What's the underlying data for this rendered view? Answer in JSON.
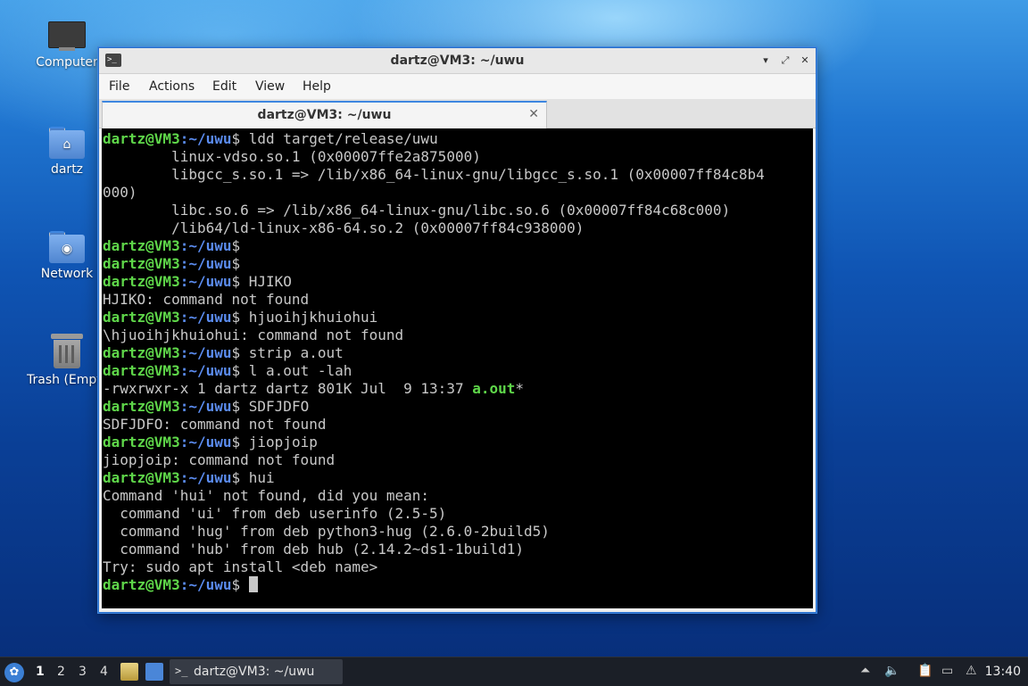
{
  "desktop": {
    "icons": [
      {
        "label": "Computer"
      },
      {
        "label": "dartz"
      },
      {
        "label": "Network"
      },
      {
        "label": "Trash (Empty)"
      }
    ]
  },
  "window": {
    "title": "dartz@VM3: ~/uwu",
    "tab_label": "dartz@VM3: ~/uwu",
    "menu": [
      "File",
      "Actions",
      "Edit",
      "View",
      "Help"
    ]
  },
  "terminal": {
    "prompt_user": "dartz@VM3",
    "prompt_path": ":~/uwu",
    "prompt_symbol": "$",
    "lines": [
      {
        "type": "cmd",
        "text": " ldd target/release/uwu"
      },
      {
        "type": "out",
        "text": "        linux-vdso.so.1 (0x00007ffe2a875000)"
      },
      {
        "type": "out",
        "text": "        libgcc_s.so.1 => /lib/x86_64-linux-gnu/libgcc_s.so.1 (0x00007ff84c8b4"
      },
      {
        "type": "out",
        "text": "000)"
      },
      {
        "type": "out",
        "text": "        libc.so.6 => /lib/x86_64-linux-gnu/libc.so.6 (0x00007ff84c68c000)"
      },
      {
        "type": "out",
        "text": "        /lib64/ld-linux-x86-64.so.2 (0x00007ff84c938000)"
      },
      {
        "type": "cmd",
        "text": ""
      },
      {
        "type": "cmd",
        "text": ""
      },
      {
        "type": "cmd",
        "text": " HJIKO"
      },
      {
        "type": "out",
        "text": "HJIKO: command not found"
      },
      {
        "type": "cmd",
        "text": " hjuoihjkhuiohui"
      },
      {
        "type": "out",
        "text": "\\hjuoihjkhuiohui: command not found"
      },
      {
        "type": "cmd",
        "text": " strip a.out"
      },
      {
        "type": "cmd",
        "text": " l a.out -lah"
      },
      {
        "type": "ls",
        "text": "-rwxrwxr-x 1 dartz dartz 801K Jul  9 13:37 ",
        "exec": "a.out",
        "suffix": "*"
      },
      {
        "type": "cmd",
        "text": " SDFJDFO"
      },
      {
        "type": "out",
        "text": "SDFJDFO: command not found"
      },
      {
        "type": "cmd",
        "text": " jiopjoip"
      },
      {
        "type": "out",
        "text": "jiopjoip: command not found"
      },
      {
        "type": "cmd",
        "text": " hui"
      },
      {
        "type": "out",
        "text": "Command 'hui' not found, did you mean:"
      },
      {
        "type": "out",
        "text": "  command 'ui' from deb userinfo (2.5-5)"
      },
      {
        "type": "out",
        "text": "  command 'hug' from deb python3-hug (2.6.0-2build5)"
      },
      {
        "type": "out",
        "text": "  command 'hub' from deb hub (2.14.2~ds1-1build1)"
      },
      {
        "type": "out",
        "text": "Try: sudo apt install <deb name>"
      },
      {
        "type": "cursor",
        "text": " "
      }
    ]
  },
  "taskbar": {
    "workspaces": [
      "1",
      "2",
      "3",
      "4"
    ],
    "task_label": "dartz@VM3: ~/uwu",
    "clock": "13:40"
  }
}
